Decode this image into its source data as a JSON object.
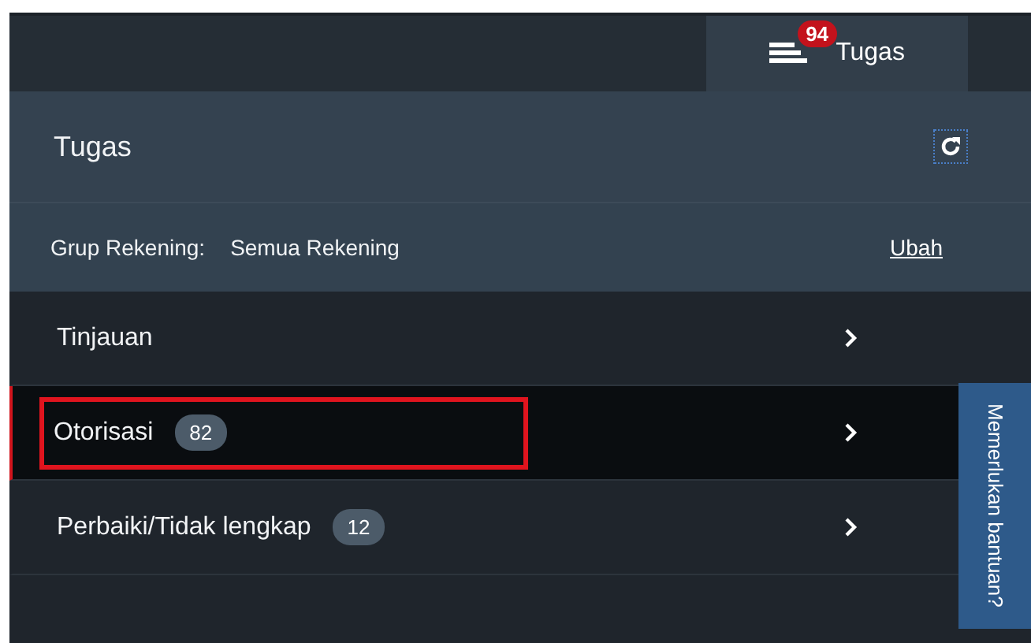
{
  "top_bar": {
    "tab": {
      "label": "Tugas",
      "badge": "94",
      "selected": true
    }
  },
  "panel": {
    "title": "Tugas",
    "account_group": {
      "label": "Grup Rekening:",
      "value": "Semua Rekening",
      "link": "Ubah"
    },
    "items": [
      {
        "label": "Tinjauan",
        "selected": false,
        "highlighted": false
      },
      {
        "label": "Otorisasi",
        "count": "82",
        "selected": true,
        "highlighted": true
      },
      {
        "label": "Perbaiki/Tidak lengkap",
        "count": "12",
        "selected": false,
        "highlighted": false
      }
    ]
  },
  "help_tab": {
    "label": "Memerlukan bantuan?"
  }
}
